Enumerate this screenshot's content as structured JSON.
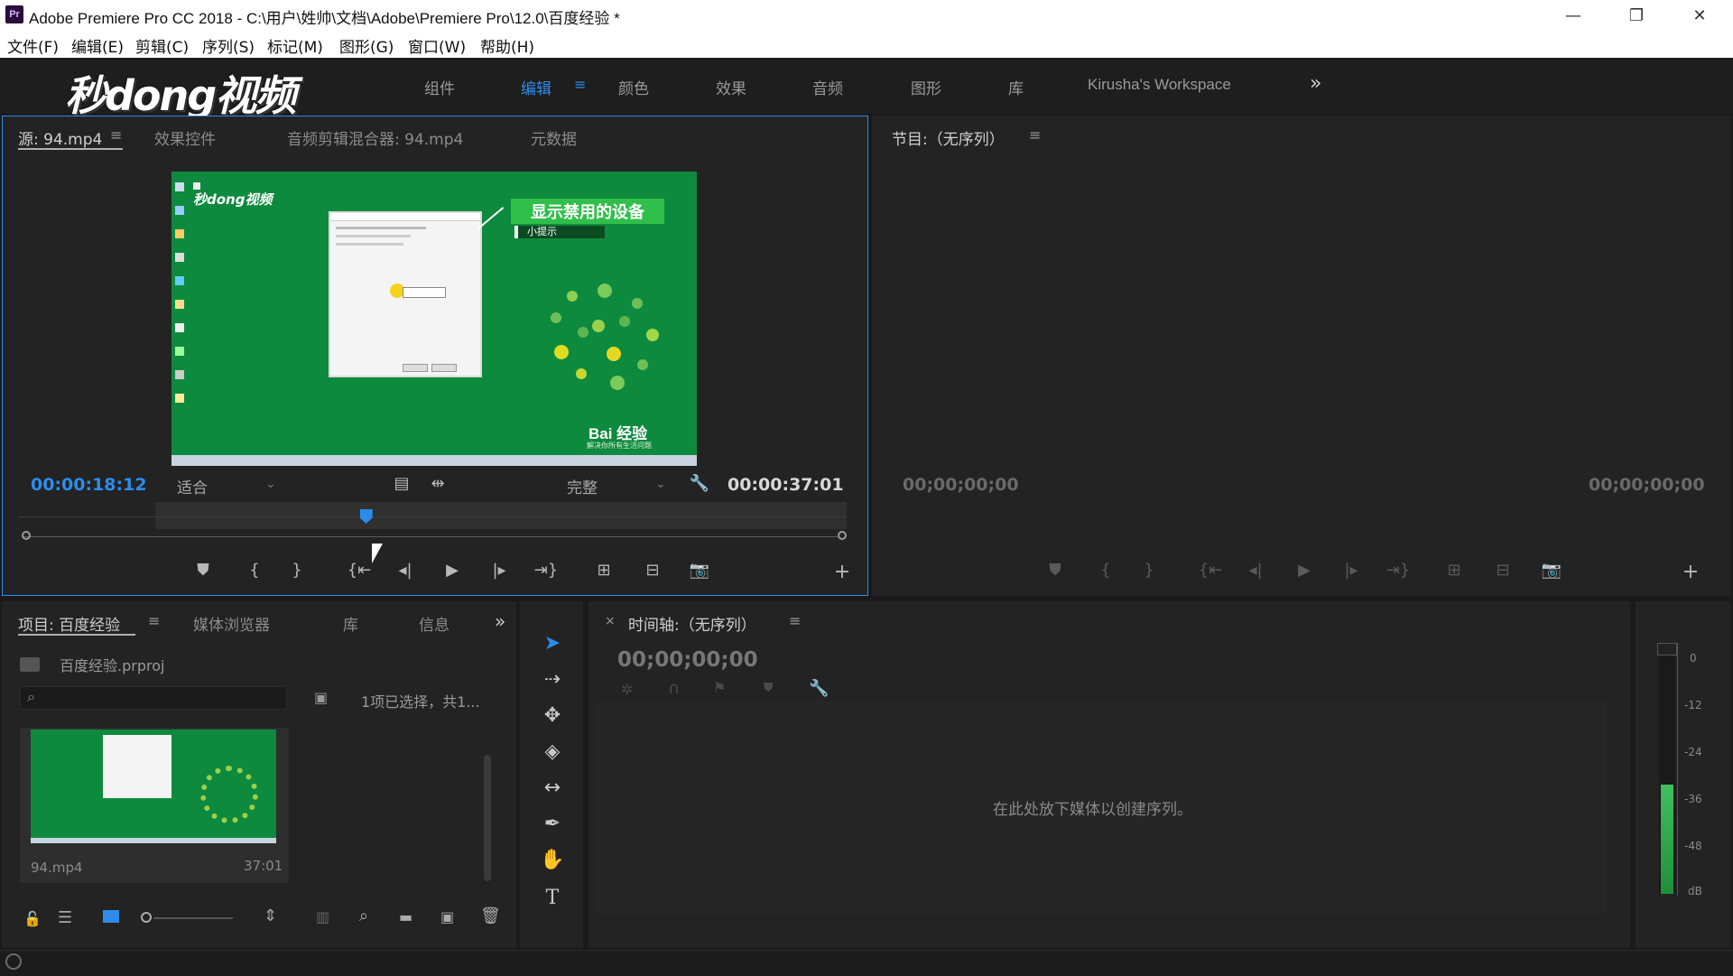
{
  "window": {
    "app_icon": "Pr",
    "title": "Adobe Premiere Pro CC 2018 - C:\\用户\\姓帅\\文档\\Adobe\\Premiere Pro\\12.0\\百度经验 *",
    "controls": [
      "minimize-icon",
      "restore-icon",
      "close-icon"
    ]
  },
  "menu": [
    "文件(F)",
    "编辑(E)",
    "剪辑(C)",
    "序列(S)",
    "标记(M)",
    "图形(G)",
    "窗口(W)",
    "帮助(H)"
  ],
  "logo": "秒dong视频",
  "workspaces": {
    "tabs": [
      "组件",
      "编辑",
      "颜色",
      "效果",
      "音频",
      "图形",
      "库",
      "Kirusha's Workspace"
    ],
    "active": "编辑",
    "more": "»"
  },
  "source_panel": {
    "tabs": [
      "源: 94.mp4",
      "效果控件",
      "音频剪辑混合器: 94.mp4",
      "元数据"
    ],
    "current_time": "00:00:18:12",
    "zoom": "适合",
    "quality": "完整",
    "duration": "00:00:37:01",
    "playhead_fraction": 0.305,
    "video": {
      "callout_title": "显示禁用的设备",
      "callout_sub": "小提示",
      "watermark": "Bai 经验",
      "watermark_sub": "解决你所有生活问题",
      "logo_text": "秒dong视频"
    }
  },
  "program_panel": {
    "title": "节目:（无序列）",
    "time_left": "00;00;00;00",
    "time_right": "00;00;00;00"
  },
  "project_panel": {
    "tabs": [
      "项目: 百度经验",
      "媒体浏览器",
      "库",
      "信息"
    ],
    "file": "百度经验.prproj",
    "selection_info": "1项已选择，共1...",
    "clip": {
      "name": "94.mp4",
      "duration": "37:01"
    }
  },
  "timeline_panel": {
    "title": "时间轴:（无序列）",
    "timecode": "00;00;00;00",
    "drop_hint": "在此处放下媒体以创建序列。"
  },
  "audio_meter": {
    "labels": [
      "0",
      "-12",
      "-24",
      "-36",
      "-48",
      "dB"
    ],
    "level_fraction": 0.46
  },
  "colors": {
    "accent": "#2d8ceb",
    "panel_bg": "#232323",
    "video_green": "#0e8a3e"
  }
}
